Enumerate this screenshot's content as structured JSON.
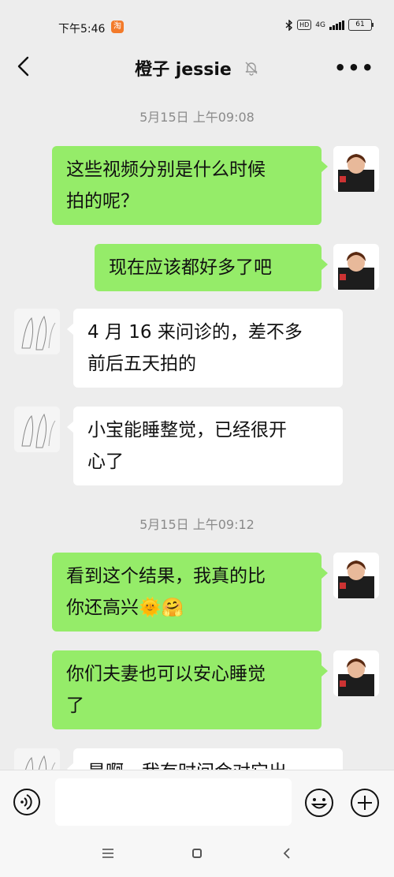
{
  "status_bar": {
    "time": "下午5:46",
    "app_badge": "淘",
    "hd": "HD",
    "network": "4G",
    "battery": "61"
  },
  "header": {
    "title": "橙子 jessie"
  },
  "messages": [
    {
      "kind": "time",
      "text": "5月15日 上午09:08"
    },
    {
      "kind": "out",
      "lines": [
        "这些视频分别是什么时候",
        "拍的呢？"
      ]
    },
    {
      "kind": "out",
      "lines": [
        "现在应该都好多了吧"
      ]
    },
    {
      "kind": "in",
      "lines": [
        "4 月 16 来问诊的，差不多",
        "前后五天拍的"
      ]
    },
    {
      "kind": "in",
      "lines": [
        "小宝能睡整觉，已经很开",
        "心了"
      ]
    },
    {
      "kind": "time",
      "text": "5月15日 上午09:12"
    },
    {
      "kind": "out",
      "lines": [
        "看到这个结果，我真的比",
        "你还高兴🌞🤗"
      ]
    },
    {
      "kind": "out",
      "lines": [
        "你们夫妻也可以安心睡觉",
        "了"
      ]
    },
    {
      "kind": "in",
      "lines": [
        "是啊，我有时间会对它出"
      ]
    }
  ],
  "input": {
    "value": "",
    "placeholder": ""
  },
  "icons": {
    "back": "back-arrow-icon",
    "mute": "muted-bell-icon",
    "more": "more-dots-icon",
    "voice": "voice-icon",
    "emoji": "emoji-icon",
    "plus": "plus-icon"
  },
  "colors": {
    "outgoing_bubble": "#95ec69",
    "incoming_bubble": "#ffffff",
    "background": "#ededed"
  }
}
